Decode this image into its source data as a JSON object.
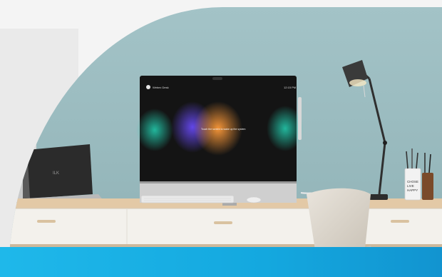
{
  "screen": {
    "top_left_label": "Webex Desk",
    "top_right_label": "12:15 PM",
    "center_message": "Touch the screen to wake up the system"
  },
  "laptop": {
    "logo_text": "ILK"
  },
  "mug": {
    "text_line1": "CHOSE",
    "text_line2": "LIVE",
    "text_line3": "HAPPY"
  },
  "colors": {
    "wall": "#9fbfc3",
    "accent_band": "#1fb8ea",
    "desk_top": "#e3c9a6",
    "desk_front": "#f3f1ec"
  }
}
